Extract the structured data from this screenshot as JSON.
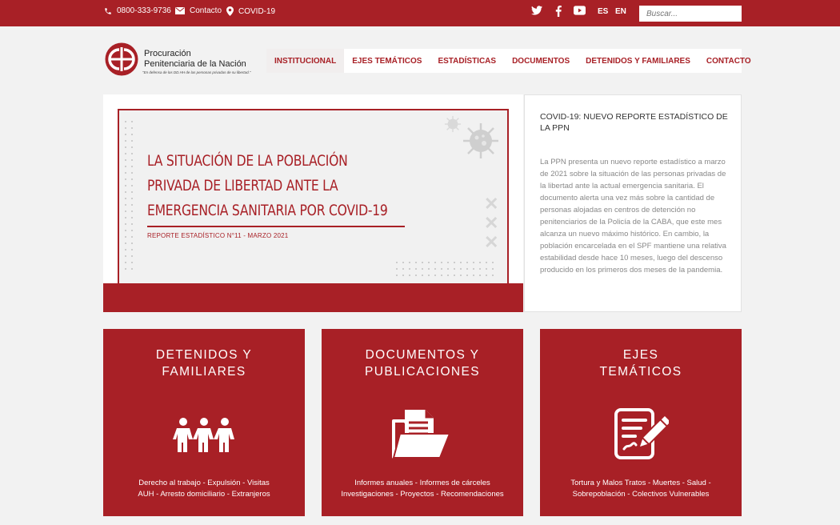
{
  "topbar": {
    "phone": "0800-333-9736",
    "contact": "Contacto",
    "covid": "COVID-19",
    "lang_es": "ES",
    "lang_en": "EN",
    "search_placeholder": "Buscar..."
  },
  "logo": {
    "name_line1": "Procuración",
    "name_line2": "Penitenciaria de la Nación",
    "tagline": "\"En defensa de los DD.HH de las personas privadas de su libertad.\""
  },
  "nav": [
    {
      "label": "INSTITUCIONAL"
    },
    {
      "label": "EJES TEMÁTICOS"
    },
    {
      "label": "ESTADÍSTICAS"
    },
    {
      "label": "DOCUMENTOS"
    },
    {
      "label": "DETENIDOS Y FAMILIARES"
    },
    {
      "label": "CONTACTO"
    }
  ],
  "hero": {
    "title_line1": "LA SITUACIÓN DE LA POBLACIÓN",
    "title_line2": "PRIVADA DE LIBERTAD ANTE LA",
    "title_line3": "EMERGENCIA SANITARIA POR COVID-19",
    "subtitle": "REPORTE ESTADÍSTICO N°11 - MARZO 2021"
  },
  "news": {
    "title": "COVID-19: NUEVO REPORTE ESTADÍSTICO DE LA PPN",
    "body": "La PPN presenta un nuevo reporte estadístico a marzo de 2021 sobre la situación de las personas privadas de la libertad ante la actual emergencia sanitaria. El documento alerta una vez más sobre la cantidad de personas alojadas en centros de detención no penitenciarios de la Policía de la CABA, que este mes alcanza un nuevo máximo histórico. En cambio, la población encarcelada en el SPF mantiene una relativa estabilidad desde hace 10 meses, luego del descenso producido en los primeros dos meses de la pandemia."
  },
  "cards": [
    {
      "title_line1": "DETENIDOS Y",
      "title_line2": "FAMILIARES",
      "icon": "people-icon",
      "links_line1": "Derecho al trabajo - Expulsión - Visitas",
      "links_line2": "AUH - Arresto domiciliario - Extranjeros"
    },
    {
      "title_line1": "DOCUMENTOS Y",
      "title_line2": "PUBLICACIONES",
      "icon": "folder-document-icon",
      "links_line1": "Informes anuales - Informes de cárceles",
      "links_line2": "Investigaciones - Proyectos - Recomendaciones"
    },
    {
      "title_line1": "EJES",
      "title_line2": "TEMÁTICOS",
      "icon": "document-pen-icon",
      "links_line1": "Tortura y Malos Tratos - Muertes - Salud -",
      "links_line2": "Sobrepoblación - Colectivos Vulnerables"
    }
  ],
  "colors": {
    "brand": "#a82026",
    "background": "#f2f2f2"
  }
}
